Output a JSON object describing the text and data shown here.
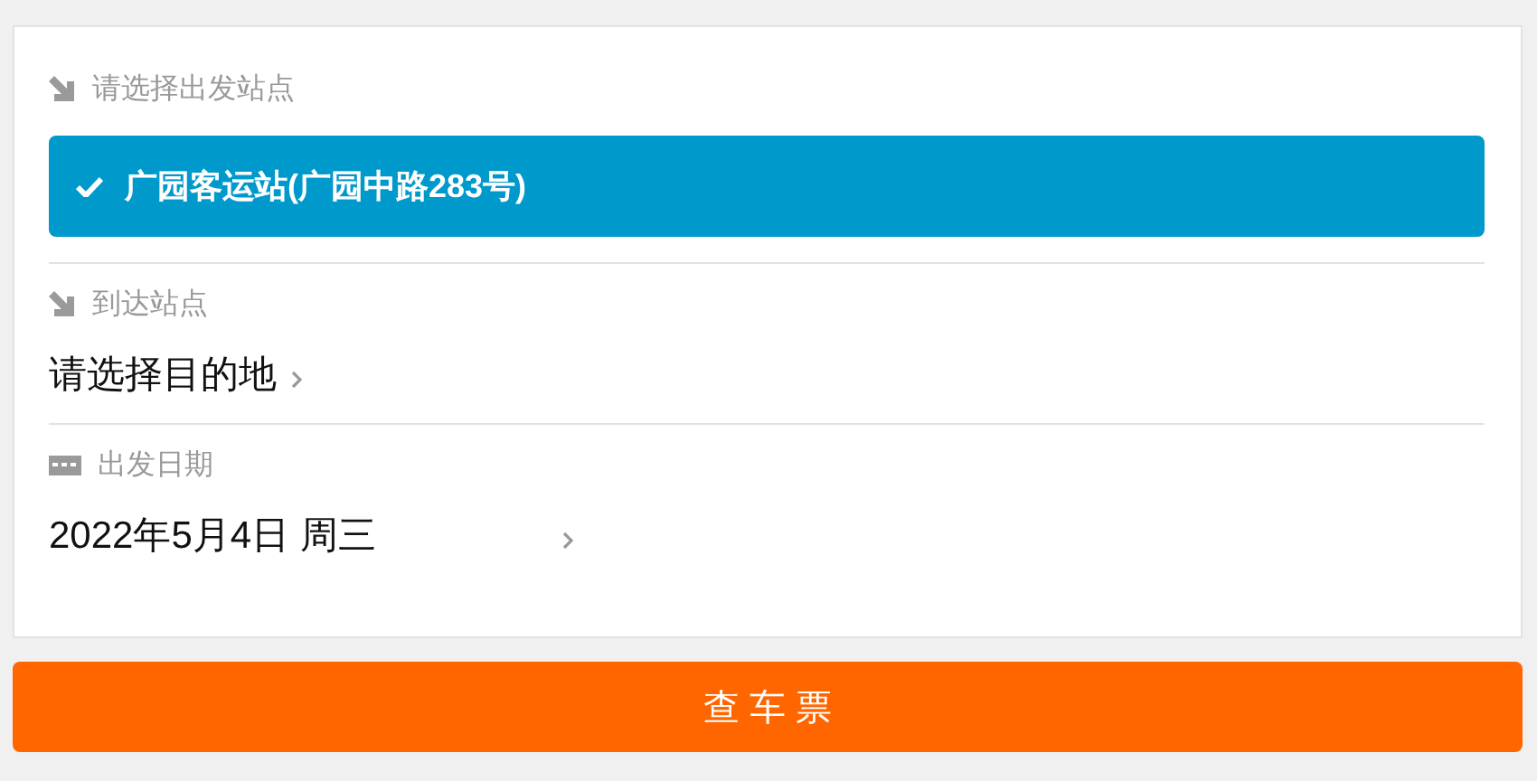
{
  "departure": {
    "label": "请选择出发站点",
    "options": [
      {
        "name": "广园客运站(广园中路283号)",
        "selected": true
      }
    ]
  },
  "arrival": {
    "label": "到达站点",
    "placeholder": "请选择目的地"
  },
  "date": {
    "label": "出发日期",
    "value": "2022年5月4日 周三"
  },
  "search_button": "查 车 票"
}
